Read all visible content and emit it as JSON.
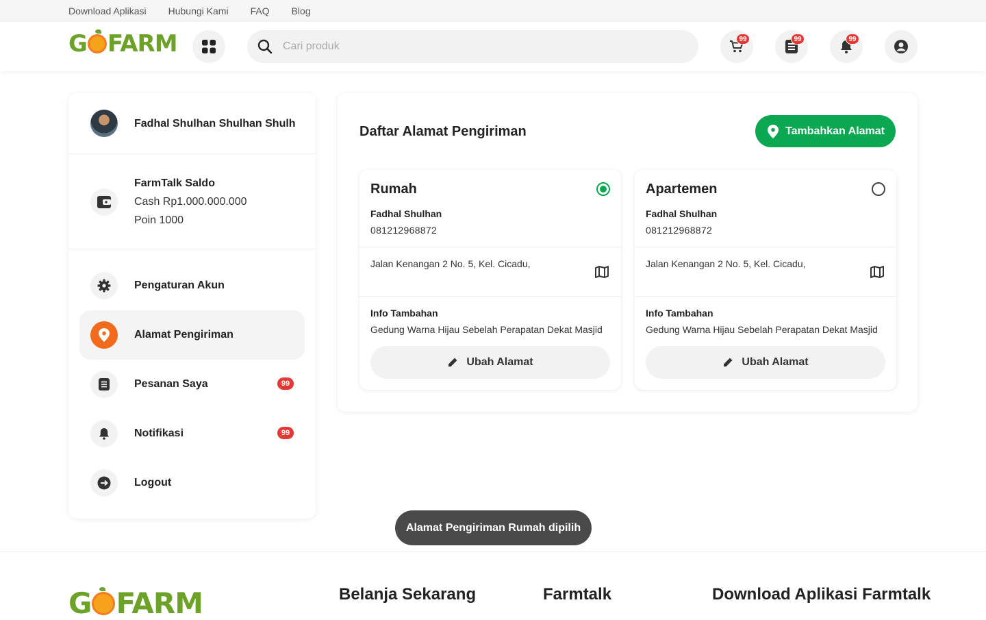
{
  "topbar": {
    "links": [
      "Download Aplikasi",
      "Hubungi Kami",
      "FAQ",
      "Blog"
    ]
  },
  "header": {
    "logo": "GOFARM",
    "search_placeholder": "Cari produk",
    "cart_badge": "99",
    "orders_badge": "99",
    "notif_badge": "99"
  },
  "sidebar": {
    "user_name": "Fadhal Shulhan Shulhan Shulh...",
    "saldo_title": "FarmTalk Saldo",
    "cash": "Cash Rp1.000.000.000",
    "poin": "Poin 1000",
    "menu": [
      {
        "label": "Pengaturan Akun",
        "badge": ""
      },
      {
        "label": "Alamat Pengiriman",
        "badge": ""
      },
      {
        "label": "Pesanan Saya",
        "badge": "99"
      },
      {
        "label": "Notifikasi",
        "badge": "99"
      },
      {
        "label": "Logout",
        "badge": ""
      }
    ]
  },
  "main": {
    "title": "Daftar Alamat Pengiriman",
    "add_button": "Tambahkan Alamat",
    "addresses": [
      {
        "label": "Rumah",
        "selected": true,
        "name": "Fadhal Shulhan",
        "phone": "081212968872",
        "address": "Jalan Kenangan 2 No. 5, Kel. Cicadu,",
        "info_title": "Info Tambahan",
        "info": "Gedung Warna Hijau Sebelah Perapatan Dekat Masjid",
        "edit_button": "Ubah Alamat"
      },
      {
        "label": "Apartemen",
        "selected": false,
        "name": "Fadhal Shulhan",
        "phone": "081212968872",
        "address": "Jalan Kenangan 2 No. 5, Kel. Cicadu,",
        "info_title": "Info Tambahan",
        "info": "Gedung Warna Hijau Sebelah Perapatan Dekat Masjid",
        "edit_button": "Ubah Alamat"
      }
    ]
  },
  "toast": {
    "prefix": "Alamat Pengiriman",
    "strong": "Rumah",
    "suffix": "dipilih"
  },
  "footer": {
    "logo": "GOFARM",
    "col1": "Belanja Sekarang",
    "col2": "Farmtalk",
    "col3": "Download Aplikasi Farmtalk"
  },
  "colors": {
    "primary_green": "#0aa851",
    "accent_orange": "#f26a1b",
    "badge_red": "#e53935",
    "logo_green": "#6da228"
  }
}
